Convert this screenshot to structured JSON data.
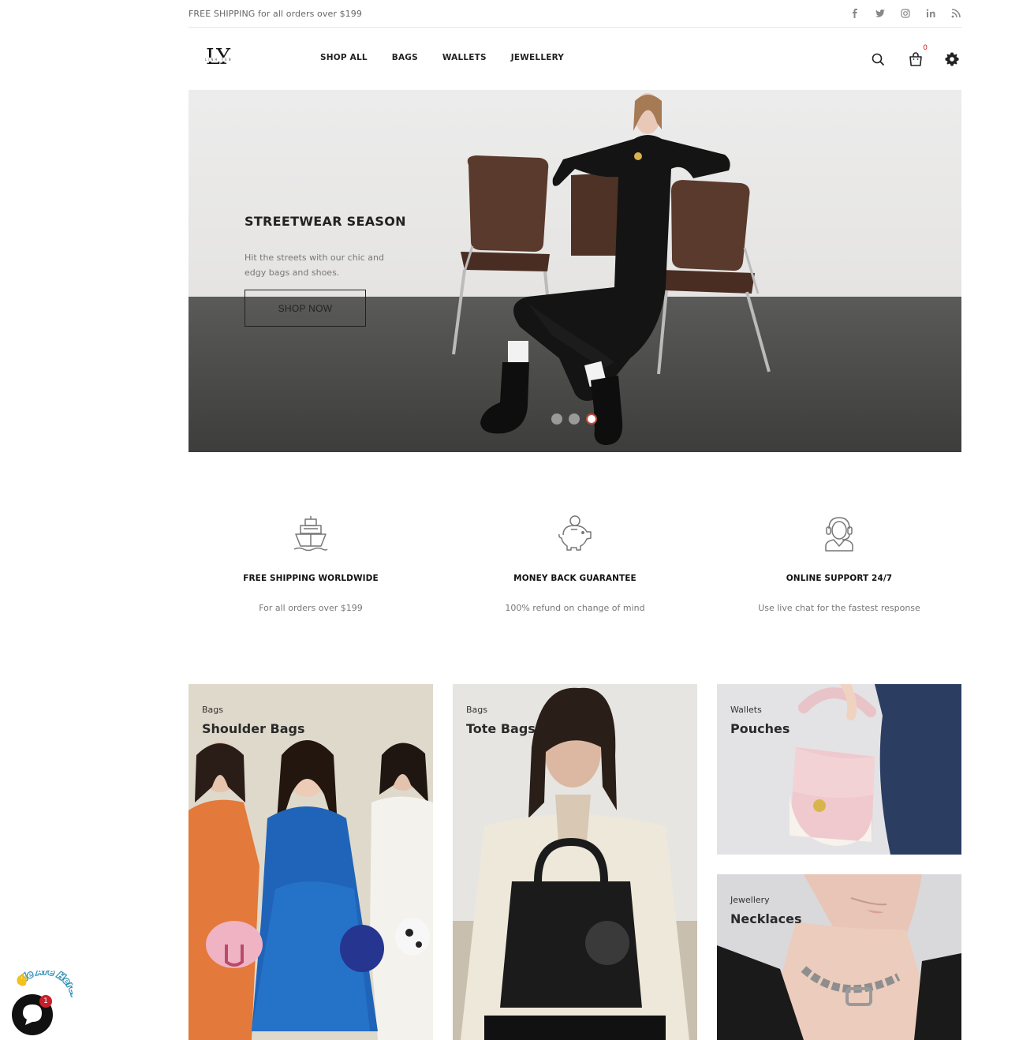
{
  "topbar": {
    "promo": "FREE SHIPPING for all orders over $199",
    "socials": [
      "facebook-icon",
      "twitter-icon",
      "instagram-icon",
      "linkedin-icon",
      "rss-icon"
    ]
  },
  "header": {
    "logo_mark": "LY",
    "logo_sub": "LINH YEN",
    "nav": [
      "SHOP ALL",
      "BAGS",
      "WALLETS",
      "JEWELLERY"
    ],
    "cart_count": "0"
  },
  "hero": {
    "title": "STREETWEAR SEASON",
    "description": "Hit the streets with our chic and edgy bags and shoes.",
    "button": "SHOP NOW",
    "slides": 3,
    "active_slide": 3
  },
  "features": [
    {
      "icon": "ship-icon",
      "title": "FREE SHIPPING WORLDWIDE",
      "text": "For all orders over $199"
    },
    {
      "icon": "piggy-bank-icon",
      "title": "MONEY BACK GUARANTEE",
      "text": "100% refund on change of mind"
    },
    {
      "icon": "support-agent-icon",
      "title": "ONLINE SUPPORT 24/7",
      "text": "Use live chat for the fastest response"
    }
  ],
  "categories": [
    {
      "category": "Bags",
      "name": "Shoulder Bags"
    },
    {
      "category": "Bags",
      "name": "Tote Bags"
    },
    {
      "category": "Wallets",
      "name": "Pouches"
    },
    {
      "category": "Jewellery",
      "name": "Necklaces"
    }
  ],
  "chat": {
    "badge": "1",
    "label": "We Are Here!"
  },
  "colors": {
    "accent_red": "#c8202a",
    "text_dark": "#222222",
    "text_muted": "#777777"
  }
}
